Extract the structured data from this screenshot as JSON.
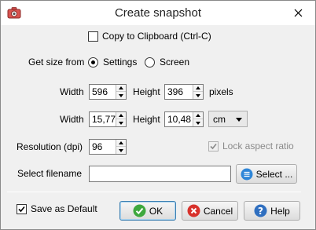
{
  "window": {
    "title": "Create snapshot"
  },
  "clipboard": {
    "label": "Copy to Clipboard (Ctrl-C)",
    "checked": false
  },
  "get_size": {
    "label": "Get size from",
    "options": [
      {
        "label": "Settings",
        "selected": true
      },
      {
        "label": "Screen",
        "selected": false
      }
    ]
  },
  "pixels_row": {
    "width_label": "Width",
    "width_value": "596",
    "height_label": "Height",
    "height_value": "396",
    "unit_label": "pixels"
  },
  "units_row": {
    "width_label": "Width",
    "width_value": "15,77",
    "height_label": "Height",
    "height_value": "10,48",
    "unit_selected": "cm"
  },
  "resolution": {
    "label": "Resolution (dpi)",
    "value": "96"
  },
  "lock_aspect": {
    "label": "Lock aspect ratio",
    "checked": true,
    "enabled": false
  },
  "filename": {
    "label": "Select filename",
    "value": "",
    "select_button": "Select ..."
  },
  "footer": {
    "save_default": {
      "label": "Save as Default",
      "checked": true
    },
    "ok_label": "OK",
    "cancel_label": "Cancel",
    "help_label": "Help"
  },
  "colors": {
    "ok_icon": "#3ea83e",
    "cancel_icon": "#d8312b",
    "help_icon": "#2f6fc0",
    "select_icon": "#2f86d8"
  }
}
